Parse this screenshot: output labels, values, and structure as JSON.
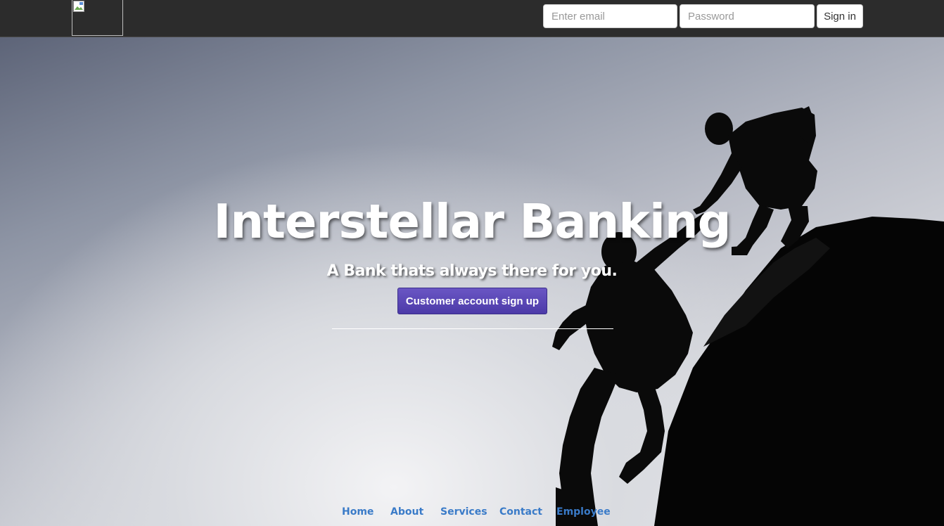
{
  "navbar": {
    "logo_icon": "broken-image-icon",
    "email_placeholder": "Enter email",
    "password_placeholder": "Password",
    "signin_label": "Sign in",
    "background_color": "#2c2c2c"
  },
  "hero": {
    "title": "Interstellar Banking",
    "subtitle": "A Bank thats always there for you.",
    "signup_label": "Customer account sign up",
    "signup_color": "#5443b6",
    "background_image": "climbers-silhouette"
  },
  "footer": {
    "links": [
      {
        "label": "Home"
      },
      {
        "label": "About"
      },
      {
        "label": "Services"
      },
      {
        "label": "Contact"
      },
      {
        "label": "Employee"
      }
    ],
    "link_color": "#3a7bc8"
  }
}
